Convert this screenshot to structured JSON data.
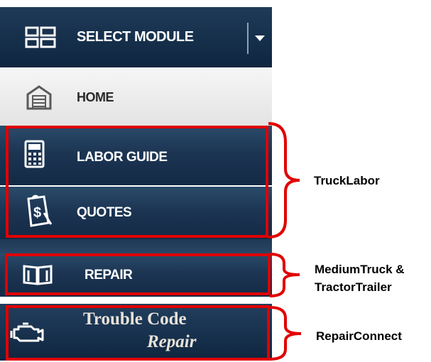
{
  "menu": {
    "header": {
      "label": "SELECT MODULE",
      "icon": "grid-icon",
      "dropdown_icon": "caret-down-icon"
    },
    "items": [
      {
        "label": "HOME",
        "icon": "garage-icon"
      },
      {
        "label": "LABOR GUIDE",
        "icon": "calculator-icon"
      },
      {
        "label": "QUOTES",
        "icon": "quote-document-icon"
      },
      {
        "label": "REPAIR",
        "icon": "book-icon"
      },
      {
        "label_line1": "Trouble Code",
        "label_line2": "Repair",
        "icon": "engine-icon"
      }
    ]
  },
  "annotations": {
    "group1": "TruckLabor",
    "group2_line1": "MediumTruck &",
    "group2_line2": "TractorTrailer",
    "group3": "RepairConnect"
  },
  "colors": {
    "panel_dark": "#1c3553",
    "home_bg": "#ebebeb",
    "highlight_red": "#e00000"
  }
}
